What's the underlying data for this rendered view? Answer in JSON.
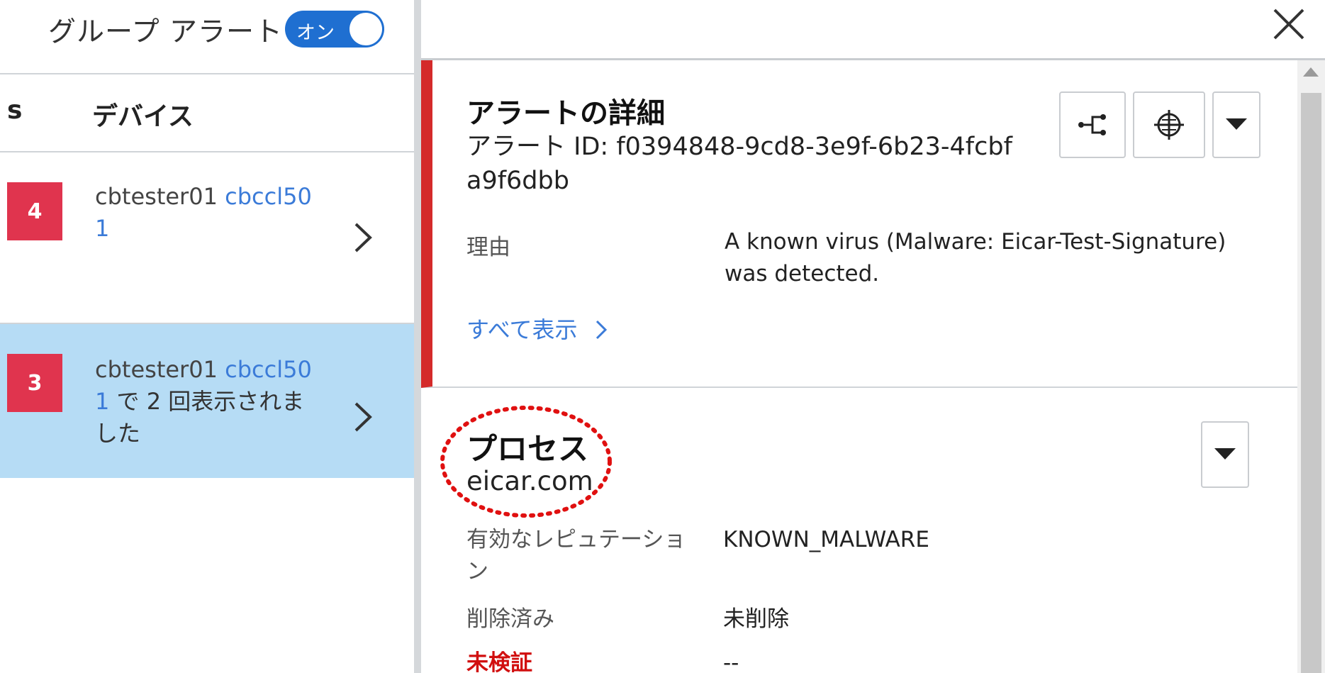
{
  "left_pane": {
    "group_alert_label": "グループ アラート",
    "toggle_label": "オン",
    "columns": {
      "s": "s",
      "device": "デバイス"
    },
    "rows": [
      {
        "severity": "4",
        "user": "cbtester01",
        "device_a": "cbccl50",
        "device_b": "1",
        "suffix": ""
      },
      {
        "severity": "3",
        "user": "cbtester01",
        "device_a": "cbccl50",
        "device_b": "1",
        "suffix": "で 2 回表示されました"
      }
    ]
  },
  "detail_panel": {
    "title": "アラートの詳細",
    "alert_id": "アラート ID: f0394848-9cd8-3e9f-6b23-4fcbfa9f6dbb",
    "reason_label": "理由",
    "reason_value": "A known virus (Malware: Eicar-Test-Signature) was detected.",
    "show_all": "すべて表示"
  },
  "process_panel": {
    "title": "プロセス",
    "name": "eicar.com",
    "properties": [
      {
        "label": "有効なレピュテーション",
        "value": "KNOWN_MALWARE"
      },
      {
        "label": "削除済み",
        "value": "未削除"
      },
      {
        "label": "未検証",
        "value": "--"
      }
    ]
  },
  "colors": {
    "accent_blue": "#1f6fd1",
    "severity_red": "#e0344e",
    "selected_row": "#b6dcf5",
    "alert_stripe": "#d42a2a",
    "annotation_red": "#e01010"
  },
  "icons": [
    "close-icon",
    "process-tree-icon",
    "target-icon",
    "caret-down-icon",
    "chevron-right-icon"
  ]
}
